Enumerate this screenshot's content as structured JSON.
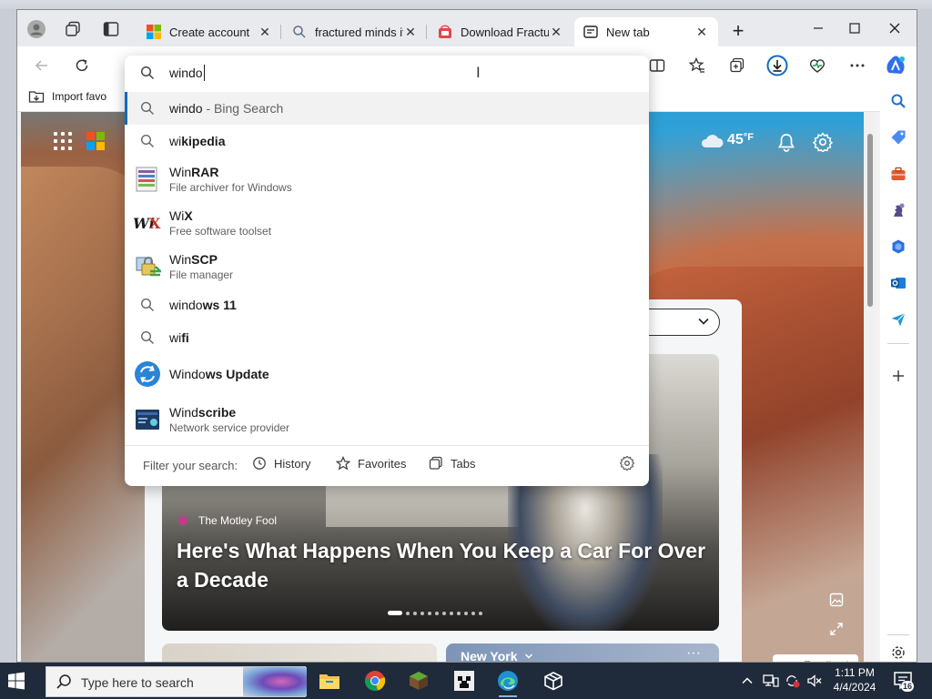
{
  "tabs": [
    {
      "label": "Create account",
      "close": "✕"
    },
    {
      "label": "fractured minds it",
      "close": "✕"
    },
    {
      "label": "Download Fractu",
      "close": "✕"
    },
    {
      "label": "New tab",
      "close": "✕"
    }
  ],
  "favorites_bar": {
    "import_label": "Import favo"
  },
  "omnibox": {
    "query": "windo",
    "suggestions": [
      {
        "type": "search",
        "typed": "windo",
        "completion": "",
        "hint": " - Bing Search",
        "subtitle": ""
      },
      {
        "type": "search",
        "typed": "wi",
        "completion": "kipedia",
        "hint": "",
        "subtitle": ""
      },
      {
        "type": "app",
        "icon": "winrar-icon",
        "typed": "Win",
        "completion": "RAR",
        "hint": "",
        "subtitle": "File archiver for Windows"
      },
      {
        "type": "app",
        "icon": "wix-logo-icon",
        "typed": "Wi",
        "completion": "X",
        "hint": "",
        "subtitle": "Free software toolset"
      },
      {
        "type": "app",
        "icon": "winscp-icon",
        "typed": "Win",
        "completion": "SCP",
        "hint": "",
        "subtitle": "File manager"
      },
      {
        "type": "search",
        "typed": "windo",
        "completion": "ws 11",
        "hint": "",
        "subtitle": ""
      },
      {
        "type": "search",
        "typed": "wi",
        "completion": "fi",
        "hint": "",
        "subtitle": ""
      },
      {
        "type": "app",
        "icon": "windows-update-icon",
        "typed": "Windo",
        "completion": "ws Update",
        "hint": "",
        "subtitle": ""
      },
      {
        "type": "app",
        "icon": "windscribe-icon",
        "typed": "Wind",
        "completion": "scribe",
        "hint": "",
        "subtitle": "Network service provider"
      }
    ],
    "footer": {
      "label": "Filter your search:",
      "filters": [
        "History",
        "Favorites",
        "Tabs"
      ]
    }
  },
  "page": {
    "weather": {
      "temp": "45",
      "unit": "°F"
    },
    "hero": {
      "source": "The Motley Fool",
      "title": "Here's What Happens When You Keep a Car For Over a Decade"
    },
    "card_city": "New York",
    "card_more": "···",
    "feedback": "Feedback"
  },
  "taskbar": {
    "search_placeholder": "Type here to search",
    "time": "1:11 PM",
    "date": "4/4/2024",
    "notification_count": "16"
  },
  "colors": {
    "accent": "#0f6cbd",
    "taskbar": "#1f2a3a",
    "copilot": "#2f6fed"
  }
}
